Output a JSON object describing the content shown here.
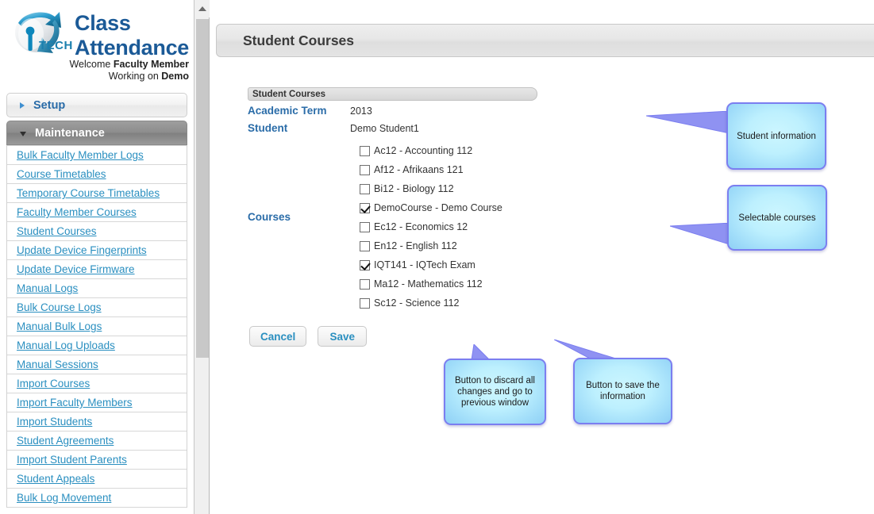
{
  "brand": {
    "logo_icon": "iqtech-globe-logo",
    "title_line1": "Class",
    "title_line2": "Attendance",
    "welcome_prefix": "Welcome ",
    "welcome_role": "Faculty Member",
    "working_prefix": "Working on ",
    "working_value": "Demo"
  },
  "sidebar": {
    "groups": [
      {
        "label": "Setup",
        "expanded": false,
        "icon": "chevron-right-icon"
      },
      {
        "label": "Maintenance",
        "expanded": true,
        "icon": "chevron-down-icon"
      }
    ],
    "items": [
      {
        "label": "Bulk Faculty Member Logs"
      },
      {
        "label": "Course Timetables"
      },
      {
        "label": "Temporary Course Timetables"
      },
      {
        "label": "Faculty Member Courses"
      },
      {
        "label": "Student Courses"
      },
      {
        "label": "Update Device Fingerprints"
      },
      {
        "label": "Update Device Firmware"
      },
      {
        "label": "Manual Logs"
      },
      {
        "label": "Bulk Course Logs"
      },
      {
        "label": "Manual Bulk Logs"
      },
      {
        "label": "Manual Log Uploads"
      },
      {
        "label": "Manual Sessions"
      },
      {
        "label": "Import Courses"
      },
      {
        "label": "Import Faculty Members"
      },
      {
        "label": "Import Students"
      },
      {
        "label": "Student Agreements"
      },
      {
        "label": "Import Student Parents"
      },
      {
        "label": "Student Appeals"
      },
      {
        "label": "Bulk Log Movement"
      }
    ]
  },
  "scrollbar": {
    "up_icon": "chevron-up-icon"
  },
  "page": {
    "title": "Student Courses"
  },
  "form": {
    "panel_title": "Student Courses",
    "academic_term_label": "Academic Term",
    "academic_term_value": "2013",
    "student_label": "Student",
    "student_value": "Demo Student1",
    "courses_label": "Courses",
    "courses": [
      {
        "code": "Ac12",
        "name": "Accounting 112",
        "label": "Ac12 - Accounting 112",
        "checked": false
      },
      {
        "code": "Af12",
        "name": "Afrikaans 121",
        "label": "Af12 - Afrikaans 121",
        "checked": false
      },
      {
        "code": "Bi12",
        "name": "Biology 112",
        "label": "Bi12 - Biology 112",
        "checked": false
      },
      {
        "code": "DemoCourse",
        "name": "Demo Course",
        "label": "DemoCourse - Demo Course",
        "checked": true
      },
      {
        "code": "Ec12",
        "name": "Economics 12",
        "label": "Ec12 - Economics 12",
        "checked": false
      },
      {
        "code": "En12",
        "name": "English 112",
        "label": "En12 - English 112",
        "checked": false
      },
      {
        "code": "IQT141",
        "name": "IQTech Exam",
        "label": "IQT141 - IQTech Exam",
        "checked": true
      },
      {
        "code": "Ma12",
        "name": "Mathematics 112",
        "label": "Ma12 - Mathematics 112",
        "checked": false
      },
      {
        "code": "Sc12",
        "name": "Science 112",
        "label": "Sc12 - Science 112",
        "checked": false
      }
    ]
  },
  "buttons": {
    "cancel_label": "Cancel",
    "save_label": "Save"
  },
  "callouts": {
    "student_information": "Student information",
    "selectable_courses": "Selectable courses",
    "cancel_help": "Button to discard all changes and go to previous window",
    "save_help": "Button to save the information"
  },
  "colors": {
    "brand_blue": "#1b5a97",
    "link_blue": "#2a8fc0",
    "label_blue": "#2a6ca8",
    "callout_border": "#7b7ef0",
    "callout_fill": "#bdf0fe",
    "group_expanded_bg": "#8d8d8d"
  }
}
